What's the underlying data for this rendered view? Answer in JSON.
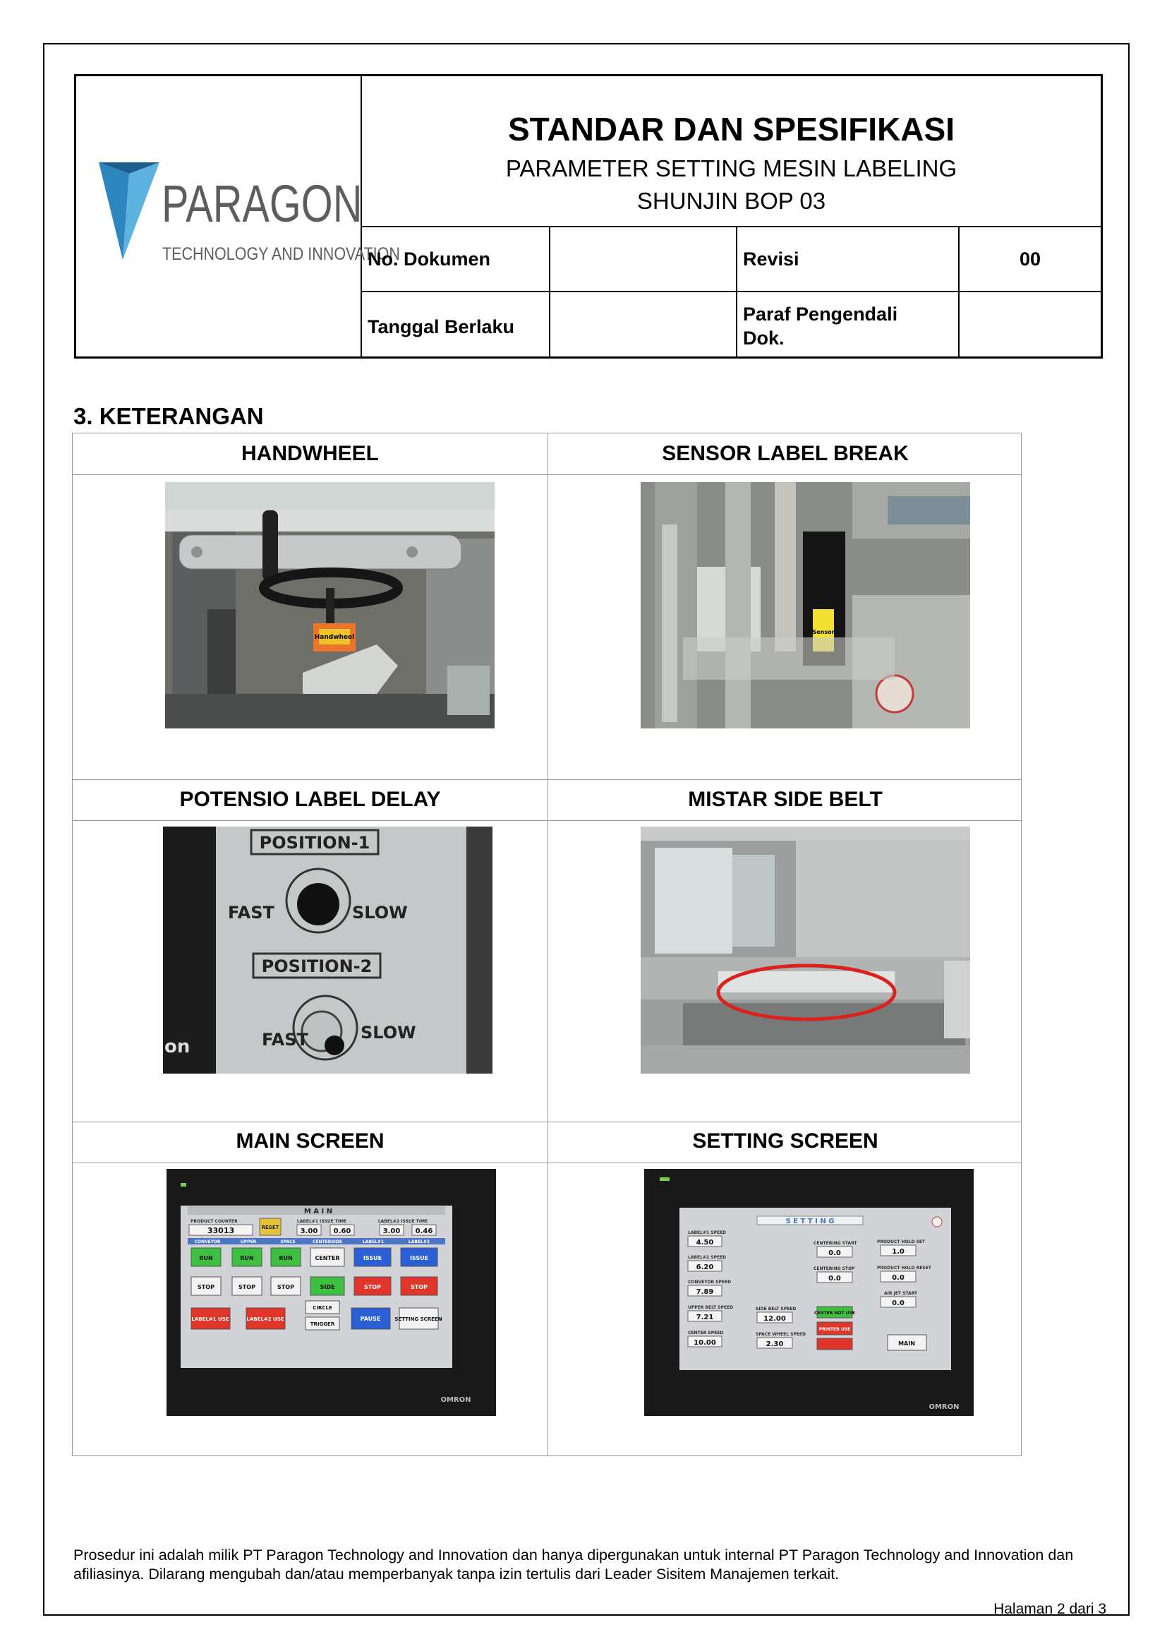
{
  "header": {
    "title": "STANDAR DAN SPESIFIKASI",
    "subtitle_1": "PARAMETER SETTING MESIN LABELING",
    "subtitle_2": "SHUNJIN BOP 03",
    "logo_word": "PARAGON",
    "logo_tagline": "TECHNOLOGY AND INNOVATION",
    "no_dokumen_label": "No. Dokumen",
    "no_dokumen_value": "",
    "revisi_label": "Revisi",
    "revisi_value": "00",
    "tanggal_label": "Tanggal Berlaku",
    "tanggal_value": "",
    "paraf_label_1": "Paraf Pengendali",
    "paraf_label_2": "Dok.",
    "paraf_value": ""
  },
  "section": {
    "title": "3. KETERANGAN",
    "items": [
      {
        "label": "HANDWHEEL"
      },
      {
        "label": "SENSOR LABEL BREAK"
      },
      {
        "label": "POTENSIO LABEL DELAY"
      },
      {
        "label": "MISTAR SIDE BELT"
      },
      {
        "label": "MAIN SCREEN"
      },
      {
        "label": "SETTING SCREEN"
      }
    ]
  },
  "photos": {
    "handwheel_tag": "Handwheel",
    "sensor_tag": "Sensor",
    "potensio_position_1": "POSITION-1",
    "potensio_position_2": "POSITION-2",
    "potensio_fast": "FAST",
    "potensio_slow": "SLOW",
    "omron": "OMRON",
    "main_screen": {
      "title": "M A I N",
      "product_counter_label": "PRODUCT COUNTER",
      "product_counter_value": "33013",
      "reset": "RESET",
      "label1_issue_time": "LABEL#1 ISSUE TIME",
      "label2_issue_time": "LABEL#2 ISSUE TIME",
      "v_300a": "3.00",
      "v_060": "0.60",
      "v_300b": "3.00",
      "v_046": "0.46",
      "col_headers": [
        "CONVEYOR",
        "UPPER",
        "SPACE",
        "CENTERSIDE",
        "LABEL#1",
        "LABEL#2"
      ],
      "row1": [
        "RUN",
        "RUN",
        "RUN",
        "CENTER",
        "ISSUE",
        "ISSUE"
      ],
      "row2": [
        "STOP",
        "STOP",
        "STOP",
        "SIDE",
        "STOP",
        "STOP"
      ],
      "label1_use": "LABEL#1 USE",
      "label2_use": "LABEL#2 USE",
      "circle": "CIRCLE",
      "trigger": "TRIGGER",
      "pause": "PAUSE",
      "setting_screen": "SETTING SCREEN"
    },
    "setting_screen": {
      "title": "S E T T I N G",
      "fields": [
        {
          "label": "LABEL#1 SPEED",
          "value": "4.50"
        },
        {
          "label": "LABEL#2 SPEED",
          "value": "6.20"
        },
        {
          "label": "CONVEYOR SPEED",
          "value": "7.89"
        },
        {
          "label": "UPPER BELT SPEED",
          "value": "7.21"
        },
        {
          "label": "CENTER SPEED",
          "value": "10.00"
        }
      ],
      "mid_fields": [
        {
          "label": "CENTERING START",
          "value": "0.0"
        },
        {
          "label": "CENTERING STOP",
          "value": "0.0"
        },
        {
          "label": "SIDE BELT SPEED",
          "value": "12.00"
        },
        {
          "label": "SPACE WHEEL SPEED",
          "value": "2.30"
        }
      ],
      "right_fields": [
        {
          "label": "PRODUCT HOLD SET",
          "value": "1.0"
        },
        {
          "label": "PRODUCT HOLD RESET",
          "value": "0.0"
        },
        {
          "label": "AIR JET START",
          "value": "0.0"
        }
      ],
      "center_not_use": "CENTER NOT USE",
      "printer_use": "PRINTER USE",
      "main_button": "MAIN"
    }
  },
  "footer": {
    "text": "Prosedur ini adalah milik PT Paragon Technology and Innovation dan hanya dipergunakan untuk internal PT Paragon Technology and Innovation dan afiliasinya. Dilarang mengubah dan/atau memperbanyak tanpa izin tertulis dari Leader Sisitem Manajemen terkait.",
    "page": "Halaman 2 dari 3"
  }
}
